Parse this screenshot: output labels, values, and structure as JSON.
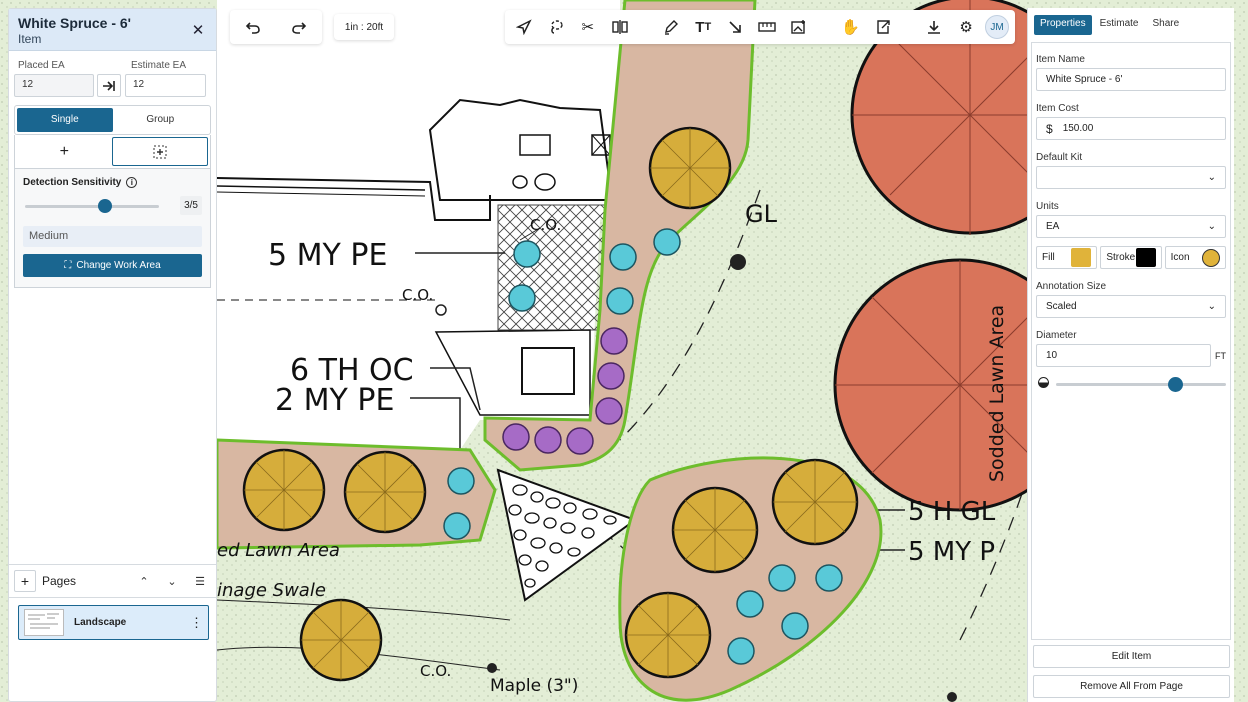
{
  "canvas": {
    "labels": {
      "my_pe_5": "5 MY PE",
      "co_1": "C.O.",
      "co_2": "C.O.",
      "co_3": "C.O.",
      "th_oc": "6 TH OC",
      "my_pe_2": "2 MY PE",
      "gl": "GL",
      "lawn_left": "ed Lawn Area",
      "swale": "inage Swale",
      "maple": "Maple (3\")",
      "gl_right": "5 H GL",
      "my_pe_right": "5 MY P",
      "sodded": "Sodded Lawn Area"
    },
    "colors": {
      "ground": "#e3eed6",
      "bed": "#d8b7a2",
      "bed_edge": "#6dbd2c",
      "yellow_plant": "#d6ad3b",
      "cyan_plant": "#59c9d8",
      "purple_plant": "#a66bc6",
      "red_tree": "#d9745a"
    }
  },
  "left_panel": {
    "title": "White Spruce - 6'",
    "subtitle": "Item",
    "placed_ea_label": "Placed EA",
    "placed_ea_value": "12",
    "estimate_ea_label": "Estimate EA",
    "estimate_ea_value": "12",
    "mode_single": "Single",
    "mode_group": "Group",
    "detection_label": "Detection Sensitivity",
    "detection_value": "3/5",
    "detection_level": 0.6,
    "sensitivity_text": "Medium",
    "change_area": "Change Work Area",
    "pages_label": "Pages",
    "page_name": "Landscape"
  },
  "toolbar": {
    "scale": "1in : 20ft",
    "avatar": "JM",
    "icons": [
      "undo-icon",
      "redo-icon",
      "select-arrow-icon",
      "lasso-icon",
      "scissors-icon",
      "split-icon",
      "pencil-icon",
      "text-icon",
      "arrow-icon",
      "ruler-icon",
      "image-add-icon",
      "hand-icon",
      "export-icon",
      "download-icon",
      "settings-icon"
    ]
  },
  "right_panel": {
    "tabs": [
      "Properties",
      "Estimate",
      "Share"
    ],
    "item_name_label": "Item Name",
    "item_name": "White Spruce - 6'",
    "item_cost_label": "Item Cost",
    "currency": "$",
    "item_cost": "150.00",
    "default_kit_label": "Default Kit",
    "default_kit": "",
    "units_label": "Units",
    "units": "EA",
    "fill_label": "Fill",
    "fill_color": "#e0b33a",
    "stroke_label": "Stroke",
    "stroke_color": "#000000",
    "icon_label": "Icon",
    "annotation_size_label": "Annotation Size",
    "annotation_size": "Scaled",
    "diameter_label": "Diameter",
    "diameter": "10",
    "diameter_unit": "FT",
    "opacity_level": 0.7,
    "edit_item": "Edit Item",
    "remove_all": "Remove All From Page"
  }
}
